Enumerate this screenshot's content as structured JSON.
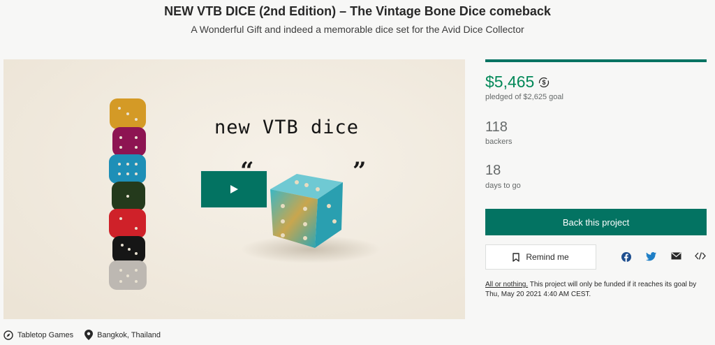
{
  "header": {
    "title": "NEW VTB DICE (2nd Edition) – The Vintage Bone Dice comeback",
    "subtitle": "A Wonderful Gift and indeed a memorable dice set for the Avid Dice Collector"
  },
  "video": {
    "heading": "new VTB dice",
    "quote_open": "“",
    "quote_close": "”",
    "play_icon": "play-icon"
  },
  "meta": {
    "category": "Tabletop Games",
    "category_icon": "compass-icon",
    "location": "Bangkok, Thailand",
    "location_icon": "map-pin-icon"
  },
  "stats": {
    "progress_percent": 100,
    "pledged": "$5,465",
    "pledged_label": "pledged of $2,625 goal",
    "backers": "118",
    "backers_label": "backers",
    "days": "18",
    "days_label": "days to go"
  },
  "actions": {
    "back_label": "Back this project",
    "remind_label": "Remind me",
    "share_icons": [
      "facebook-icon",
      "twitter-icon",
      "email-icon",
      "embed-icon"
    ]
  },
  "funding": {
    "link_text": "All or nothing.",
    "text": " This project will only be funded if it reaches its goal by Thu, May 20 2021 4:40 AM CEST."
  },
  "colors": {
    "accent": "#037362",
    "pledged": "#028858",
    "muted": "#656969",
    "background": "#f7f7f6"
  }
}
